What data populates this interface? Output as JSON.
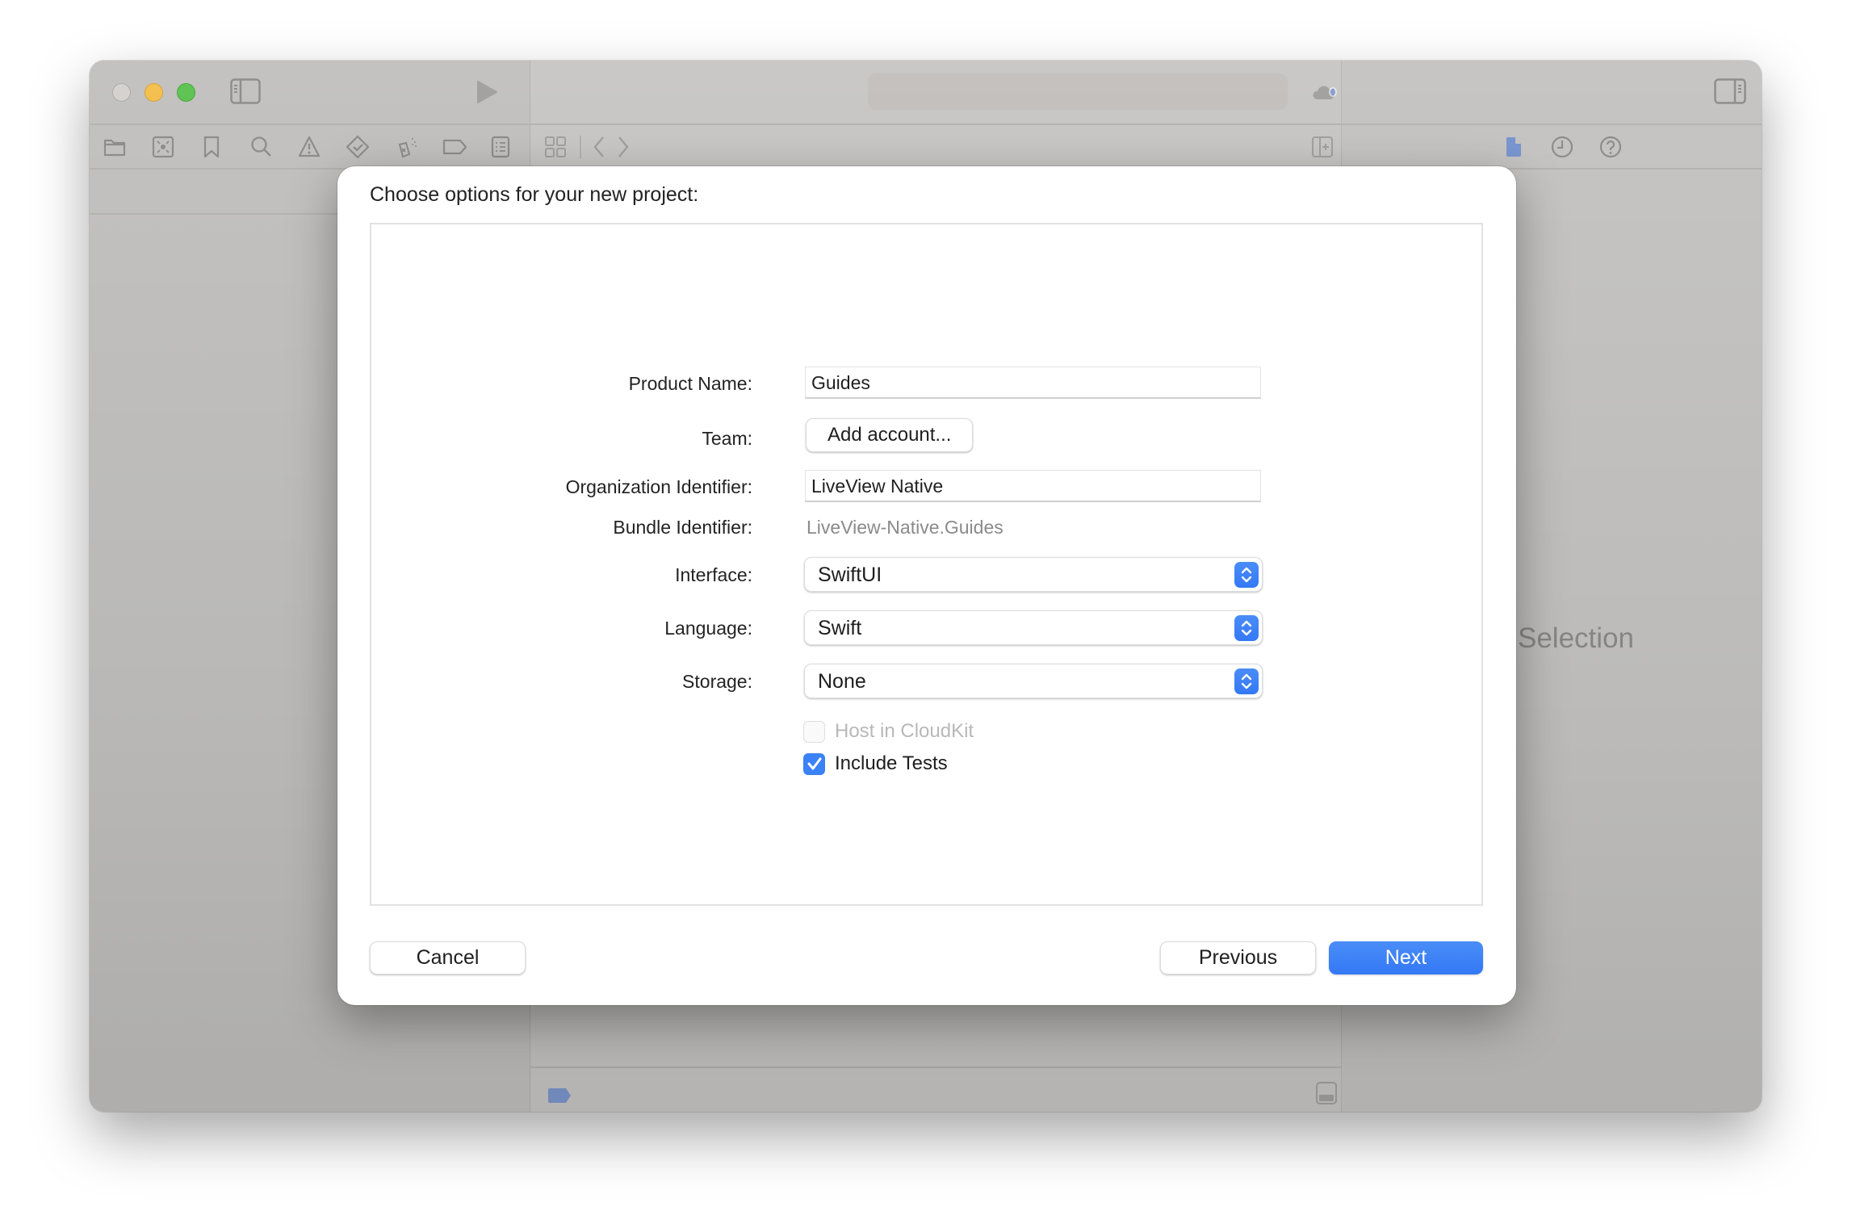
{
  "window": {
    "traffic_lights": [
      "close",
      "minimize",
      "zoom"
    ],
    "toolbar": {
      "left_icons": [
        "sidebar-toggle-icon",
        "run-icon"
      ],
      "center_icons": [
        "cloud-status-icon",
        "add-icon"
      ],
      "right_icons": [
        "inspector-toggle-icon"
      ]
    },
    "navigator_icons": [
      "folder-icon",
      "source-control-icon",
      "bookmark-icon",
      "search-icon",
      "warning-icon",
      "test-icon",
      "debug-icon",
      "breakpoint-icon",
      "report-icon"
    ],
    "editor_icons": [
      "grid-icon",
      "back-icon",
      "forward-icon",
      "add-editor-icon"
    ],
    "inspector_icons": [
      "file-icon",
      "history-icon",
      "help-icon"
    ],
    "inspector_placeholder": "Selection",
    "accent_color": "#3478f6"
  },
  "dialog": {
    "title": "Choose options for your new project:",
    "fields": {
      "product_name": {
        "label": "Product Name:",
        "value": "Guides"
      },
      "team": {
        "label": "Team:",
        "button": "Add account..."
      },
      "organization_identifier": {
        "label": "Organization Identifier:",
        "value": "LiveView Native"
      },
      "bundle_identifier": {
        "label": "Bundle Identifier:",
        "value": "LiveView-Native.Guides"
      },
      "interface": {
        "label": "Interface:",
        "value": "SwiftUI"
      },
      "language": {
        "label": "Language:",
        "value": "Swift"
      },
      "storage": {
        "label": "Storage:",
        "value": "None"
      }
    },
    "checkboxes": [
      {
        "label": "Host in CloudKit",
        "checked": false,
        "enabled": false
      },
      {
        "label": "Include Tests",
        "checked": true,
        "enabled": true
      }
    ],
    "buttons": {
      "cancel": "Cancel",
      "previous": "Previous",
      "next": "Next"
    }
  }
}
